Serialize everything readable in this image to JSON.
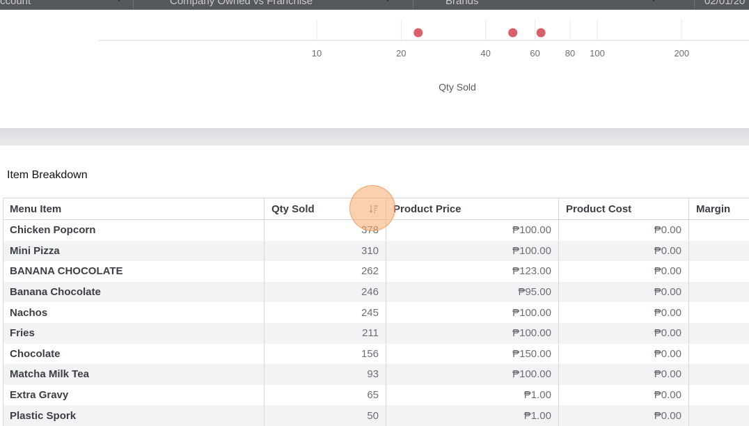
{
  "filters": [
    {
      "label": "ccount"
    },
    {
      "label": "Company Owned vs Franchise"
    },
    {
      "label": "Brands"
    },
    {
      "label": "02/01/20"
    }
  ],
  "chart_data": {
    "type": "scatter",
    "xscale": "log",
    "xlabel": "Qty Sold",
    "xticks": [
      10,
      20,
      40,
      60,
      80,
      100,
      200
    ],
    "points": [
      {
        "x": 23
      },
      {
        "x": 50
      },
      {
        "x": 63
      }
    ],
    "color": "#d9606a"
  },
  "section_title": "Item Breakdown",
  "table": {
    "columns": [
      "Menu Item",
      "Qty Sold",
      "Product Price",
      "Product Cost",
      "Margin"
    ],
    "rows": [
      {
        "item": "Chicken Popcorn",
        "qty": "378",
        "price": "₱100.00",
        "cost": "₱0.00"
      },
      {
        "item": "Mini Pizza",
        "qty": "310",
        "price": "₱100.00",
        "cost": "₱0.00"
      },
      {
        "item": "BANANA CHOCOLATE",
        "qty": "262",
        "price": "₱123.00",
        "cost": "₱0.00"
      },
      {
        "item": "Banana Chocolate",
        "qty": "246",
        "price": "₱95.00",
        "cost": "₱0.00"
      },
      {
        "item": "Nachos",
        "qty": "245",
        "price": "₱100.00",
        "cost": "₱0.00"
      },
      {
        "item": "Fries",
        "qty": "211",
        "price": "₱100.00",
        "cost": "₱0.00"
      },
      {
        "item": "Chocolate",
        "qty": "156",
        "price": "₱150.00",
        "cost": "₱0.00"
      },
      {
        "item": "Matcha Milk Tea",
        "qty": "93",
        "price": "₱100.00",
        "cost": "₱0.00"
      },
      {
        "item": "Extra Gravy",
        "qty": "65",
        "price": "₱1.00",
        "cost": "₱0.00"
      },
      {
        "item": "Plastic Spork",
        "qty": "50",
        "price": "₱1.00",
        "cost": "₱0.00"
      }
    ]
  }
}
